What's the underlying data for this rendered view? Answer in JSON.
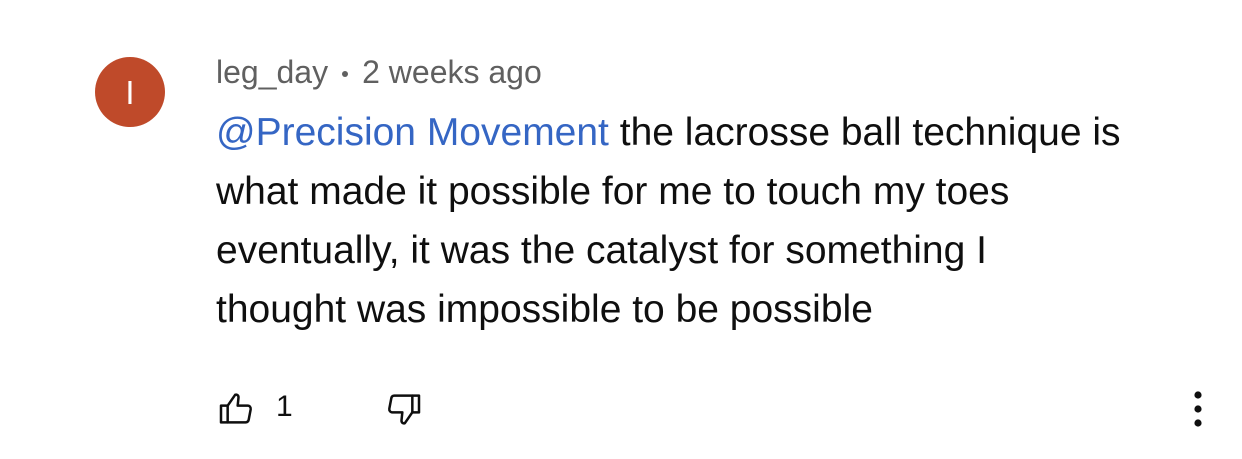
{
  "comment": {
    "avatar_letter": "I",
    "avatar_color": "#bf4a2a",
    "author": "leg_day",
    "separator": "•",
    "timestamp": "2 weeks ago",
    "mention": "@Precision Movement",
    "mention_color": "#3566c4",
    "text_lines": [
      " the lacrosse ball technique is",
      "what made it possible for me to touch my toes",
      "eventually, it was the catalyst for something I",
      "thought was impossible to be possible"
    ],
    "like_count": "1",
    "icons": {
      "like": "thumbs-up-icon",
      "dislike": "thumbs-down-icon",
      "more": "more-vertical-icon"
    }
  }
}
